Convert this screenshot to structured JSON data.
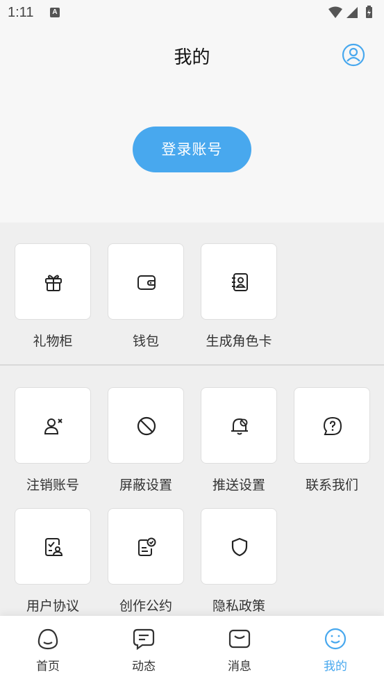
{
  "status_bar": {
    "time": "1:11",
    "notification_badge": "A"
  },
  "header": {
    "title": "我的"
  },
  "login": {
    "label": "登录账号"
  },
  "colors": {
    "accent": "#48a8ee"
  },
  "section_one": {
    "items": [
      {
        "label": "礼物柜",
        "icon": "gift-icon"
      },
      {
        "label": "钱包",
        "icon": "wallet-icon"
      },
      {
        "label": "生成角色卡",
        "icon": "contact-card-icon"
      }
    ]
  },
  "section_two": {
    "items": [
      {
        "label": "注销账号",
        "icon": "remove-user-icon"
      },
      {
        "label": "屏蔽设置",
        "icon": "block-icon"
      },
      {
        "label": "推送设置",
        "icon": "bell-off-icon"
      },
      {
        "label": "联系我们",
        "icon": "help-chat-icon"
      },
      {
        "label": "用户协议",
        "icon": "user-document-icon"
      },
      {
        "label": "创作公约",
        "icon": "document-check-icon"
      },
      {
        "label": "隐私政策",
        "icon": "shield-icon"
      }
    ]
  },
  "bottom_nav": {
    "items": [
      {
        "label": "首页",
        "icon": "home-face-icon"
      },
      {
        "label": "动态",
        "icon": "chat-bubble-icon"
      },
      {
        "label": "消息",
        "icon": "message-icon"
      },
      {
        "label": "我的",
        "icon": "smile-face-icon",
        "active": true
      }
    ]
  }
}
